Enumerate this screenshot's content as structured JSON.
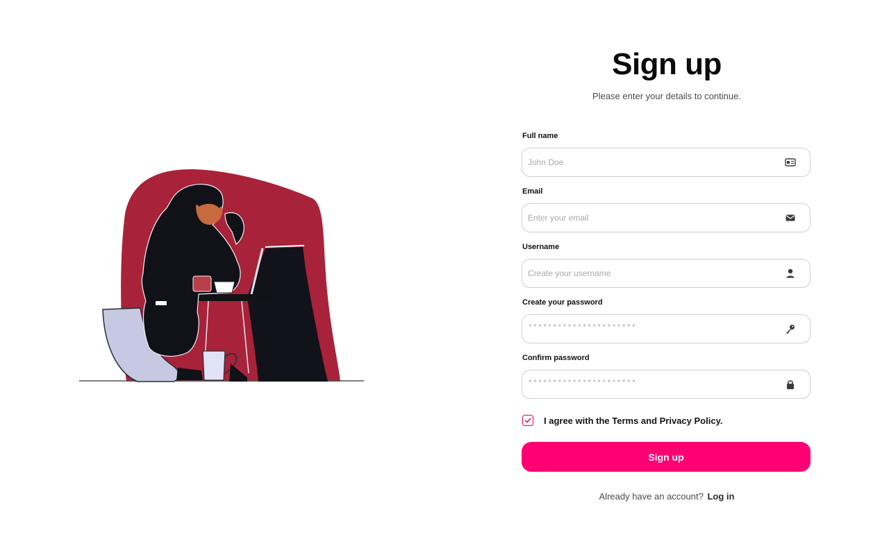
{
  "header": {
    "title": "Sign up",
    "subtitle": "Please enter your details to continue."
  },
  "form": {
    "fields": [
      {
        "label": "Full name",
        "placeholder": "John Doe",
        "icon": "id-card-icon"
      },
      {
        "label": "Email",
        "placeholder": "Enter your email",
        "icon": "envelope-icon"
      },
      {
        "label": "Username",
        "placeholder": "Create your username",
        "icon": "user-icon"
      },
      {
        "label": "Create your password",
        "mask": "**********************",
        "icon": "key-icon"
      },
      {
        "label": "Confirm password",
        "mask": "**********************",
        "icon": "lock-icon"
      }
    ],
    "agree": {
      "checked": true,
      "text": "I agree with the Terms and Privacy Policy."
    },
    "submit_label": "Sign up"
  },
  "footer": {
    "prompt": "Already have an account?",
    "login_label": "Log in"
  },
  "colors": {
    "accent": "#ff0073",
    "illustration_blob": "#a8233a",
    "dark": "#111111"
  }
}
